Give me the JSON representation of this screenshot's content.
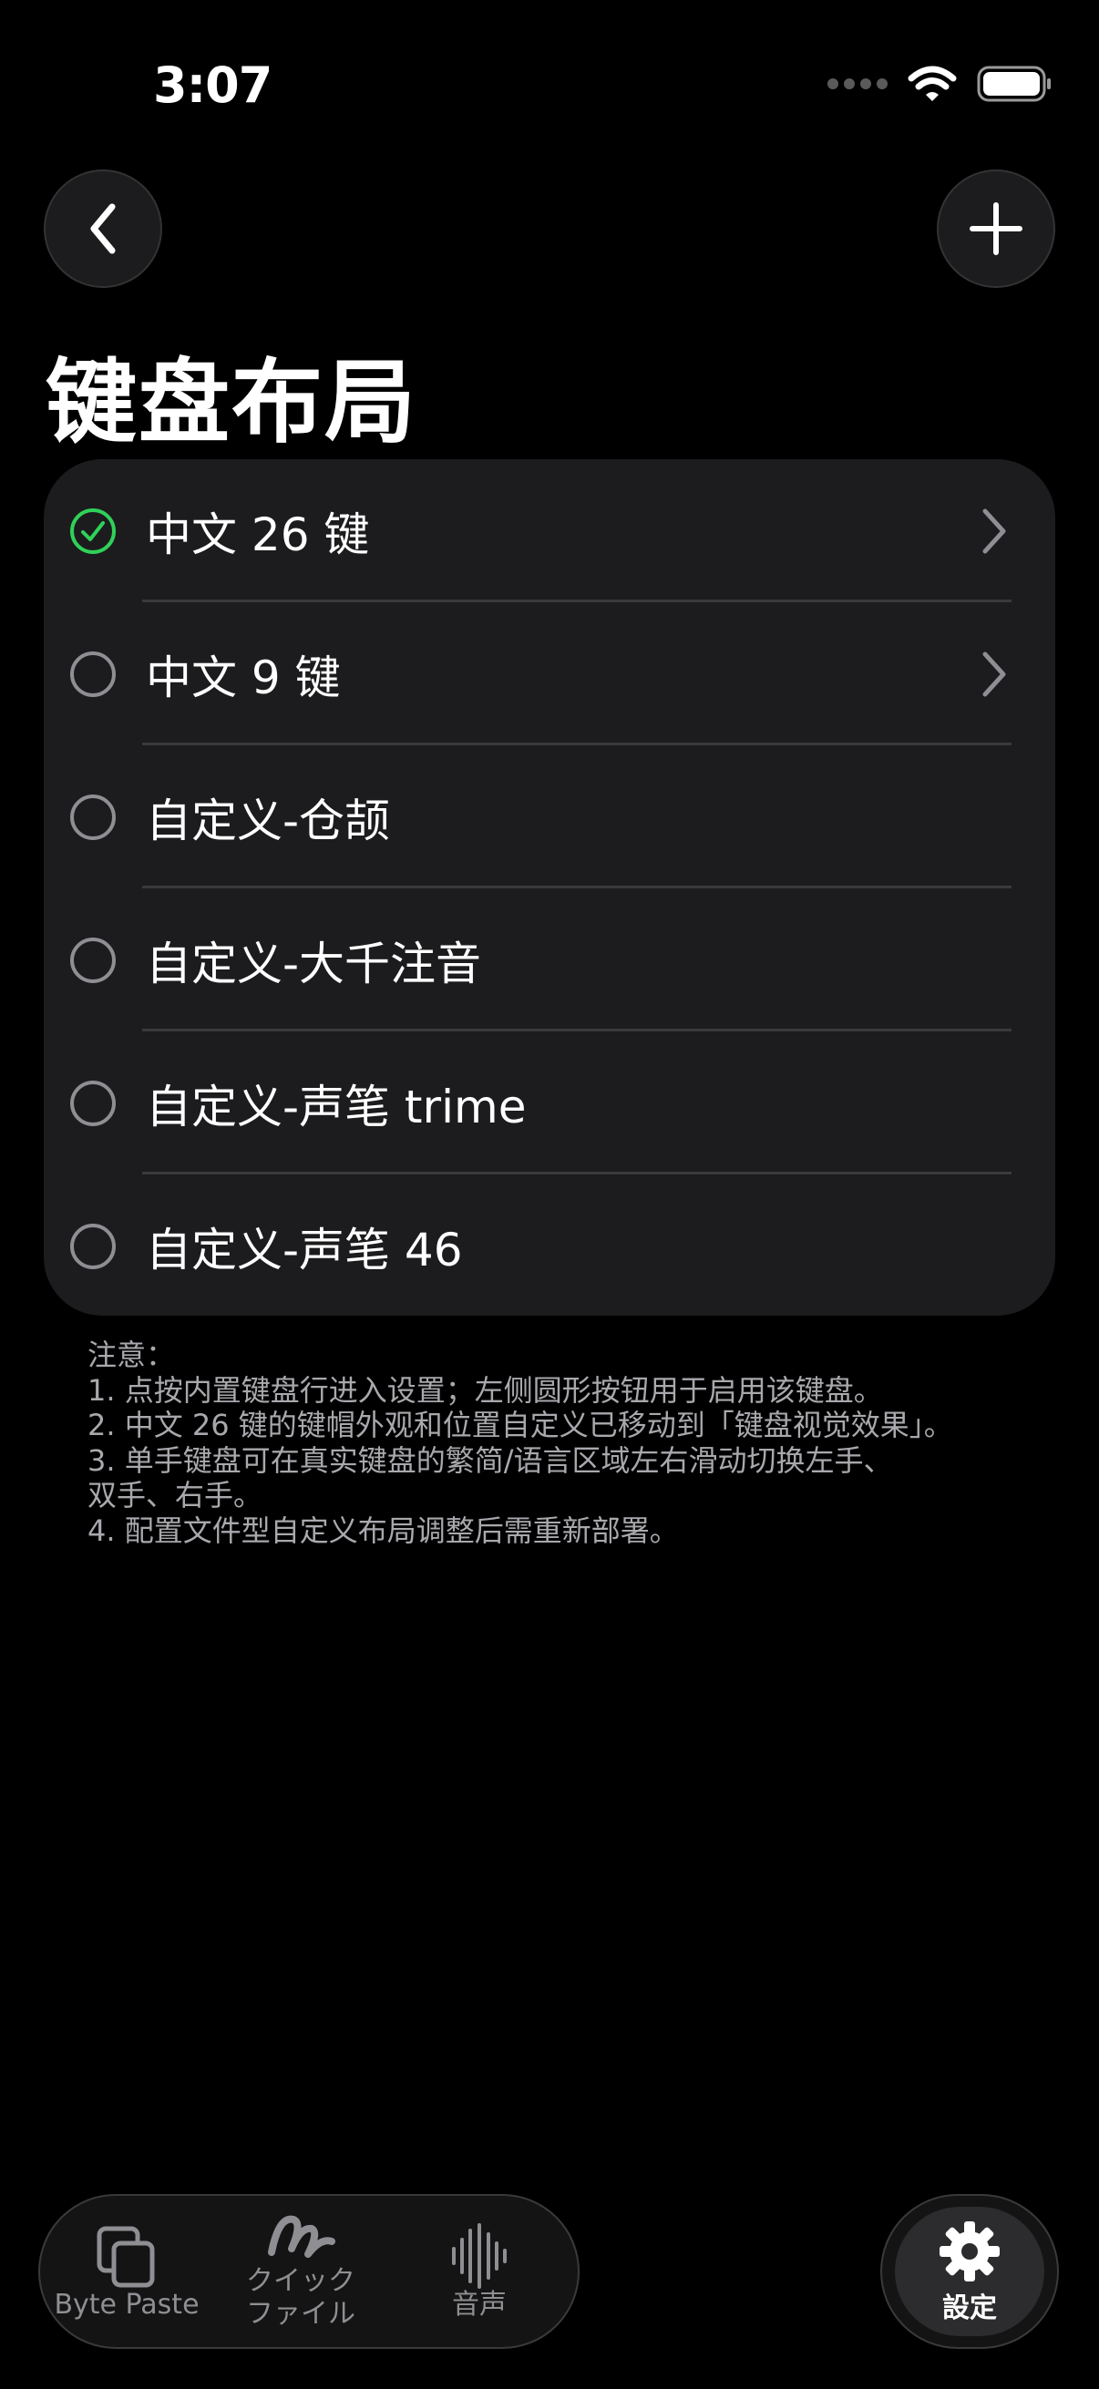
{
  "status": {
    "time": "3:07"
  },
  "page": {
    "title": "键盘布局"
  },
  "layouts": [
    {
      "label": "中文 26 键",
      "selected": true,
      "has_chevron": true
    },
    {
      "label": "中文 9 键",
      "selected": false,
      "has_chevron": true
    },
    {
      "label": "自定义-仓颉",
      "selected": false,
      "has_chevron": false
    },
    {
      "label": "自定义-大千注音",
      "selected": false,
      "has_chevron": false
    },
    {
      "label": "自定义-声笔 trime",
      "selected": false,
      "has_chevron": false
    },
    {
      "label": "自定义-声笔 46",
      "selected": false,
      "has_chevron": false
    }
  ],
  "notes": {
    "heading": "注意：",
    "lines": [
      "1. 点按内置键盘行进入设置；左侧圆形按钮用于启用该键盘。",
      "2. 中文 26 键的键帽外观和位置自定义已移动到「键盘视觉效果」。",
      "3. 单手键盘可在真实键盘的繁简/语言区域左右滑动切换左手、",
      "双手、右手。",
      "4. 配置文件型自定义布局调整后需重新部署。"
    ]
  },
  "tabbar": {
    "byte_paste": "Byte Paste",
    "quick_file_1": "クイック",
    "quick_file_2": "ファイル",
    "voice": "音声",
    "settings": "設定"
  },
  "colors": {
    "accent_green": "#30d158",
    "card_bg": "#1c1c1e",
    "background": "#000000"
  },
  "icons": {
    "back": "chevron-left-icon",
    "add": "plus-icon",
    "row_selected": "checkmark-circle-icon",
    "row_unselected": "empty-circle-icon",
    "row_disclosure": "chevron-right-icon",
    "byte_paste": "copy-icon",
    "quick_file": "scribble-icon",
    "voice": "waveform-icon",
    "settings": "gear-icon"
  }
}
